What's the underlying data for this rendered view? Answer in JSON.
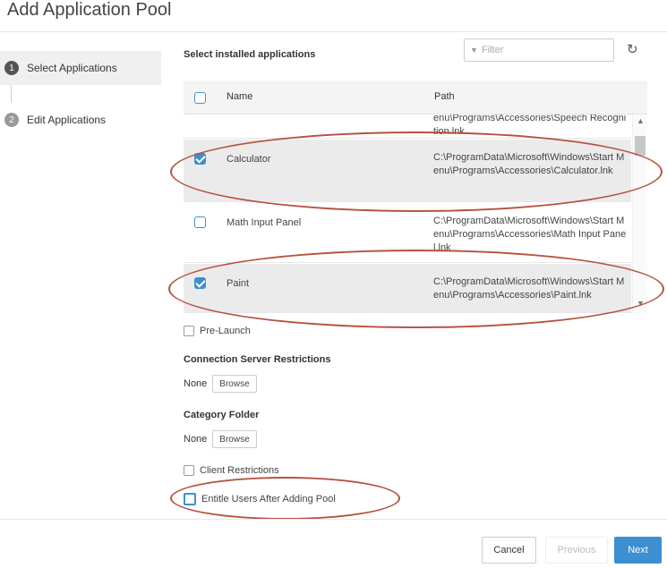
{
  "dialog": {
    "title": "Add Application Pool"
  },
  "steps": [
    {
      "number": "1",
      "label": "Select Applications",
      "active": true
    },
    {
      "number": "2",
      "label": "Edit Applications",
      "active": false
    }
  ],
  "apps_section": {
    "label": "Select installed applications",
    "filter_placeholder": "Filter",
    "columns": {
      "name": "Name",
      "path": "Path"
    },
    "rows": [
      {
        "name": "",
        "path": "C:\\ProgramData\\Microsoft\\Windows\\Start Menu\\Programs\\Accessories\\Speech Recognition.lnk",
        "checked": false,
        "partial": true
      },
      {
        "name": "Calculator",
        "path": "C:\\ProgramData\\Microsoft\\Windows\\Start Menu\\Programs\\Accessories\\Calculator.lnk",
        "checked": true
      },
      {
        "name": "Math Input Panel",
        "path": "C:\\ProgramData\\Microsoft\\Windows\\Start Menu\\Programs\\Accessories\\Math Input Panel.lnk",
        "checked": false
      },
      {
        "name": "Paint",
        "path": "C:\\ProgramData\\Microsoft\\Windows\\Start Menu\\Programs\\Accessories\\Paint.lnk",
        "checked": true
      }
    ]
  },
  "options": {
    "pre_launch": "Pre-Launch",
    "connection_server_label": "Connection Server Restrictions",
    "connection_server_value": "None",
    "category_folder_label": "Category Folder",
    "category_folder_value": "None",
    "browse_label": "Browse",
    "client_restrictions": "Client Restrictions",
    "entitle_users": "Entitle Users After Adding Pool"
  },
  "footer": {
    "cancel": "Cancel",
    "previous": "Previous",
    "next": "Next"
  },
  "colors": {
    "accent": "#3d8fd1",
    "annotation": "#b5523f"
  }
}
